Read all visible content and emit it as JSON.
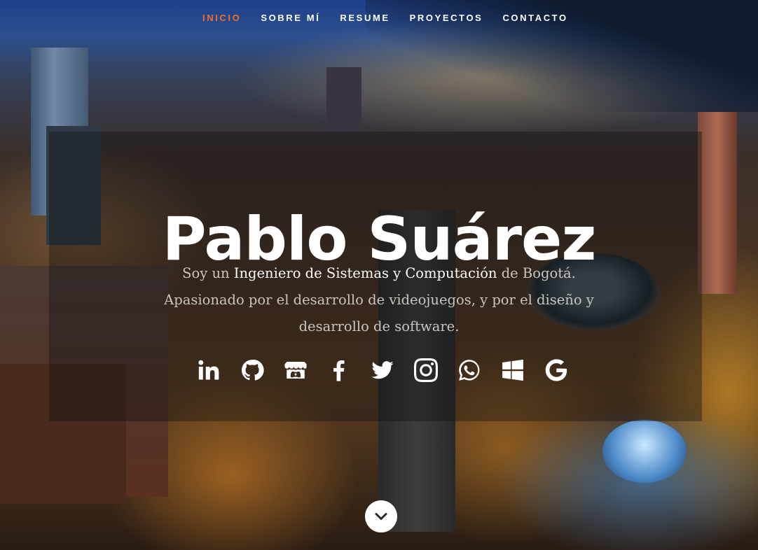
{
  "nav": {
    "items": [
      {
        "label": "INICIO",
        "active": true
      },
      {
        "label": "SOBRE MÍ",
        "active": false
      },
      {
        "label": "RESUME",
        "active": false
      },
      {
        "label": "PROYECTOS",
        "active": false
      },
      {
        "label": "CONTACTO",
        "active": false
      }
    ],
    "active_color": "#f0702a"
  },
  "hero": {
    "name": "Pablo Suárez",
    "description": {
      "part1": "Soy un ",
      "highlight": "Ingeniero de Sistemas y Computación",
      "part2": " de Bogotá. Apasionado por el desarrollo de videojuegos, y por el diseño y desarrollo de software."
    }
  },
  "social": {
    "icons": [
      "linkedin-icon",
      "github-icon",
      "itchio-icon",
      "facebook-icon",
      "twitter-icon",
      "instagram-icon",
      "whatsapp-icon",
      "windows-icon",
      "google-icon"
    ]
  },
  "scroll_down": {
    "icon": "chevron-down-icon"
  }
}
